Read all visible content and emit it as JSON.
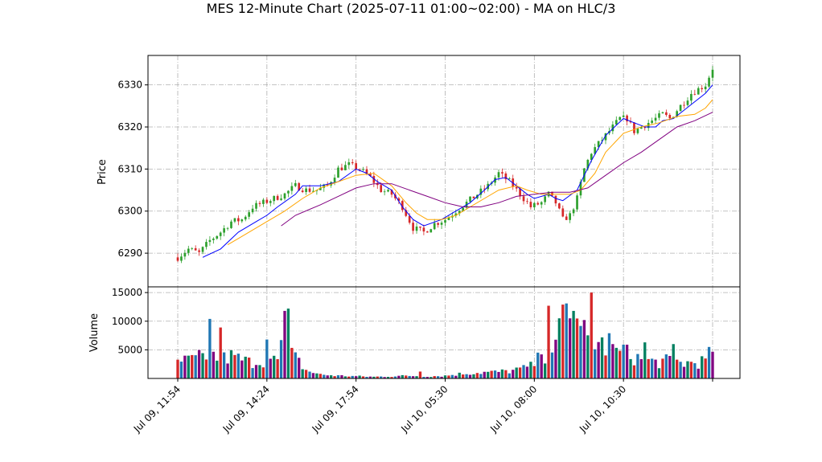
{
  "chart_data": {
    "type": "candlestick",
    "title": "MES 12-Minute Chart (2025-07-11 01:00~02:00) - MA on HLC/3",
    "price_panel": {
      "ylabel": "Price",
      "ylim": [
        6282,
        6337
      ],
      "yticks": [
        6290,
        6300,
        6310,
        6320,
        6330
      ],
      "grid": true
    },
    "volume_panel": {
      "ylabel": "Volume",
      "ylim": [
        0,
        16000
      ],
      "yticks": [
        5000,
        10000,
        15000
      ],
      "ytick_labels": [
        "5000",
        "10000",
        "15000"
      ],
      "grid": true
    },
    "x_tick_labels": [
      "Jul 09, 11:54",
      "Jul 09, 14:24",
      "Jul 09, 17:54",
      "Jul 10, 05:30",
      "Jul 10, 08:00",
      "Jul 10, 10:30"
    ],
    "x_tick_bars": [
      0,
      25,
      50,
      75,
      100,
      125,
      150
    ],
    "bar_count": 151,
    "colors": {
      "up": "#2ca02c",
      "down": "#d62728",
      "ma_fast": "#0000ff",
      "ma_mid": "#ffa500",
      "ma_slow": "#800080",
      "volume": [
        "#d62728",
        "#1f77b4",
        "#800080",
        "#008060"
      ]
    },
    "moving_averages": [
      {
        "color": "#0000ff",
        "points": [
          [
            7,
            6289
          ],
          [
            12,
            6291
          ],
          [
            17,
            6295
          ],
          [
            22,
            6297.5
          ],
          [
            25,
            6299
          ],
          [
            28,
            6301
          ],
          [
            33,
            6304
          ],
          [
            35,
            6306
          ],
          [
            40,
            6306
          ],
          [
            45,
            6307
          ],
          [
            50,
            6310
          ],
          [
            53,
            6309
          ],
          [
            56,
            6307
          ],
          [
            60,
            6305
          ],
          [
            63,
            6301
          ],
          [
            66,
            6298
          ],
          [
            69,
            6296.5
          ],
          [
            74,
            6298
          ],
          [
            78,
            6300
          ],
          [
            82,
            6302
          ],
          [
            86,
            6305
          ],
          [
            89,
            6307.5
          ],
          [
            92,
            6308
          ],
          [
            95,
            6306
          ],
          [
            98,
            6304
          ],
          [
            100,
            6303
          ],
          [
            104,
            6304
          ],
          [
            106,
            6303
          ],
          [
            108,
            6302.5
          ],
          [
            112,
            6305
          ],
          [
            116,
            6312
          ],
          [
            120,
            6318
          ],
          [
            125,
            6322
          ],
          [
            128,
            6321
          ],
          [
            131,
            6320
          ],
          [
            134,
            6320
          ],
          [
            136,
            6321.5
          ],
          [
            139,
            6322
          ],
          [
            142,
            6324
          ],
          [
            145,
            6326
          ],
          [
            148,
            6328
          ],
          [
            150,
            6330
          ]
        ]
      },
      {
        "color": "#ffa500",
        "points": [
          [
            14,
            6292
          ],
          [
            17,
            6293.5
          ],
          [
            22,
            6296
          ],
          [
            25,
            6297.5
          ],
          [
            30,
            6300
          ],
          [
            35,
            6303
          ],
          [
            40,
            6305.5
          ],
          [
            45,
            6307
          ],
          [
            50,
            6308.5
          ],
          [
            55,
            6309
          ],
          [
            60,
            6306
          ],
          [
            64,
            6302
          ],
          [
            67,
            6299.5
          ],
          [
            70,
            6298
          ],
          [
            74,
            6298
          ],
          [
            78,
            6299
          ],
          [
            82,
            6301
          ],
          [
            86,
            6303
          ],
          [
            90,
            6305
          ],
          [
            95,
            6306
          ],
          [
            98,
            6305
          ],
          [
            102,
            6304
          ],
          [
            105,
            6304
          ],
          [
            110,
            6304
          ],
          [
            113,
            6305
          ],
          [
            117,
            6309
          ],
          [
            120,
            6314
          ],
          [
            125,
            6318.5
          ],
          [
            130,
            6320
          ],
          [
            135,
            6321
          ],
          [
            140,
            6322.5
          ],
          [
            145,
            6323
          ],
          [
            148,
            6324.5
          ],
          [
            150,
            6326.5
          ]
        ]
      },
      {
        "color": "#800080",
        "points": [
          [
            29,
            6296.5
          ],
          [
            33,
            6299
          ],
          [
            40,
            6301.5
          ],
          [
            45,
            6303.5
          ],
          [
            50,
            6305.5
          ],
          [
            55,
            6306.5
          ],
          [
            60,
            6306.5
          ],
          [
            65,
            6305
          ],
          [
            70,
            6303.5
          ],
          [
            75,
            6302
          ],
          [
            80,
            6301
          ],
          [
            85,
            6301
          ],
          [
            90,
            6302
          ],
          [
            95,
            6303.5
          ],
          [
            100,
            6304
          ],
          [
            105,
            6304.5
          ],
          [
            110,
            6304.5
          ],
          [
            115,
            6305.5
          ],
          [
            120,
            6308.5
          ],
          [
            125,
            6311.5
          ],
          [
            130,
            6314
          ],
          [
            135,
            6317
          ],
          [
            140,
            6320
          ],
          [
            145,
            6321.5
          ],
          [
            150,
            6323.5
          ]
        ]
      }
    ],
    "price_path": [
      [
        0,
        6289
      ],
      [
        3,
        6291
      ],
      [
        6,
        6290
      ],
      [
        9,
        6293
      ],
      [
        12,
        6295
      ],
      [
        15,
        6297.5
      ],
      [
        18,
        6298
      ],
      [
        21,
        6301
      ],
      [
        24,
        6302
      ],
      [
        27,
        6303
      ],
      [
        30,
        6304
      ],
      [
        33,
        6306
      ],
      [
        36,
        6305
      ],
      [
        39,
        6305
      ],
      [
        42,
        6306
      ],
      [
        45,
        6310
      ],
      [
        48,
        6311
      ],
      [
        51,
        6310
      ],
      [
        54,
        6308
      ],
      [
        57,
        6305
      ],
      [
        60,
        6304
      ],
      [
        63,
        6301
      ],
      [
        66,
        6296
      ],
      [
        69,
        6295
      ],
      [
        72,
        6297
      ],
      [
        75,
        6298
      ],
      [
        78,
        6300
      ],
      [
        81,
        6302
      ],
      [
        84,
        6304
      ],
      [
        87,
        6306
      ],
      [
        90,
        6309
      ],
      [
        93,
        6307
      ],
      [
        96,
        6304
      ],
      [
        99,
        6301
      ],
      [
        102,
        6302
      ],
      [
        104,
        6304
      ],
      [
        106,
        6302
      ],
      [
        108,
        6298
      ],
      [
        110,
        6299
      ],
      [
        112,
        6303
      ],
      [
        114,
        6310
      ],
      [
        116,
        6314
      ],
      [
        118,
        6316
      ],
      [
        120,
        6318
      ],
      [
        122,
        6320
      ],
      [
        124,
        6322
      ],
      [
        126,
        6322
      ],
      [
        128,
        6319
      ],
      [
        130,
        6320
      ],
      [
        132,
        6321
      ],
      [
        134,
        6322
      ],
      [
        136,
        6323
      ],
      [
        138,
        6322
      ],
      [
        140,
        6324
      ],
      [
        142,
        6326
      ],
      [
        144,
        6328
      ],
      [
        146,
        6329
      ],
      [
        148,
        6330
      ],
      [
        150,
        6334
      ]
    ],
    "volume_profile": [
      [
        0,
        3000
      ],
      [
        5,
        3500
      ],
      [
        9,
        4500
      ],
      [
        12,
        3500
      ],
      [
        15,
        4000
      ],
      [
        20,
        3000
      ],
      [
        25,
        3500
      ],
      [
        28,
        3200
      ],
      [
        31,
        5000
      ],
      [
        34,
        3000
      ],
      [
        36,
        1500
      ],
      [
        40,
        700
      ],
      [
        45,
        500
      ],
      [
        50,
        400
      ],
      [
        55,
        300
      ],
      [
        60,
        400
      ],
      [
        65,
        500
      ],
      [
        70,
        400
      ],
      [
        75,
        500
      ],
      [
        80,
        900
      ],
      [
        85,
        1100
      ],
      [
        90,
        1200
      ],
      [
        95,
        1500
      ],
      [
        99,
        2200
      ],
      [
        103,
        4500
      ],
      [
        106,
        8500
      ],
      [
        110,
        8500
      ],
      [
        114,
        8000
      ],
      [
        118,
        6500
      ],
      [
        122,
        5000
      ],
      [
        126,
        4500
      ],
      [
        130,
        3500
      ],
      [
        134,
        3000
      ],
      [
        138,
        3200
      ],
      [
        142,
        2800
      ],
      [
        146,
        3000
      ],
      [
        150,
        3500
      ]
    ],
    "volume_spikes": [
      [
        9,
        10400
      ],
      [
        12,
        8900
      ],
      [
        25,
        6800
      ],
      [
        29,
        6700
      ],
      [
        30,
        11800
      ],
      [
        31,
        12200
      ],
      [
        68,
        1200
      ],
      [
        95,
        1900
      ],
      [
        102,
        4200
      ],
      [
        104,
        12700
      ],
      [
        107,
        10500
      ],
      [
        108,
        12900
      ],
      [
        109,
        13100
      ],
      [
        111,
        11800
      ],
      [
        114,
        10200
      ],
      [
        116,
        15000
      ],
      [
        121,
        7900
      ],
      [
        125,
        5900
      ],
      [
        131,
        6300
      ],
      [
        139,
        6000
      ],
      [
        149,
        5500
      ]
    ]
  }
}
